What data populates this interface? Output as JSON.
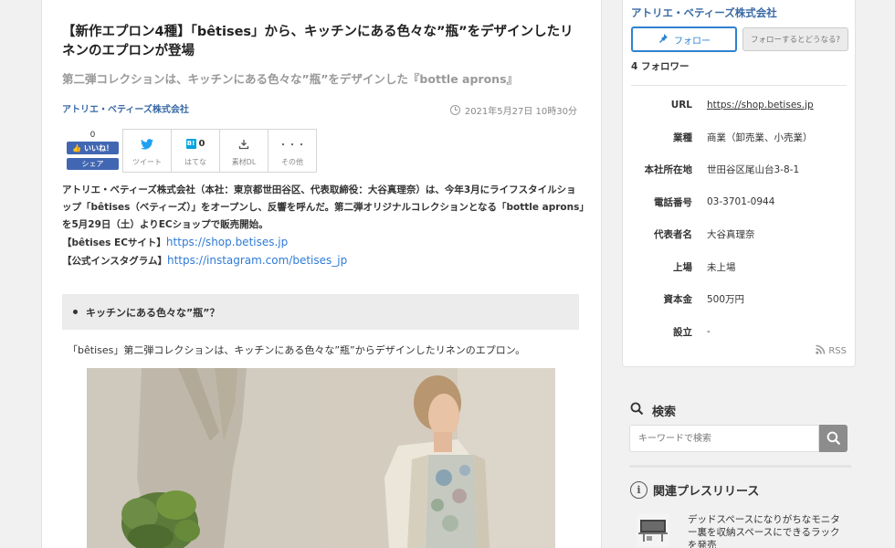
{
  "article": {
    "title": "【新作エプロン4種】「bêtises」から、キッチンにある色々な”瓶”をデザインしたリネンのエプロンが登場",
    "subtitle": "第二弾コレクションは、キッチンにある色々な”瓶”をデザインした『bottle aprons』",
    "company": "アトリエ・ベティーズ株式会社",
    "date": "2021年5月27日 10時30分",
    "body": [
      "アトリエ・ベティーズ株式会社（本社：東京都世田谷区、代表取締役：大谷真理奈）は、今年3月にライフスタイルショップ「bêtises（ベティーズ）」をオープンし、反響を呼んだ。第二弾オリジナルコレクションとなる「bottle aprons」を5月29日（土）よりECショップで販売開始。"
    ],
    "links": [
      {
        "label": "【bêtises ECサイト】",
        "url": "https://shop.betises.jp"
      },
      {
        "label": "【公式インスタグラム】",
        "url": "https://instagram.com/betises_jp"
      }
    ],
    "toc_item": "キッチンにある色々な”瓶”？",
    "lead": "「bêtises」第二弾コレクションは、キッチンにある色々な”瓶”からデザインしたリネンのエプロン。"
  },
  "share": {
    "fb_count": "0",
    "fb_like": "いいね！",
    "fb_share": "シェア",
    "tweet": "ツイート",
    "hatena_count": "0",
    "hatena": "はてな",
    "material": "素材DL",
    "more_icon": "・・・",
    "more": "その他"
  },
  "sidebar": {
    "company": "アトリエ・ベティーズ株式会社",
    "follow": "フォロー",
    "what_follow": "フォローするとどうなる?",
    "followers": "4 フォロワー",
    "info": [
      {
        "key": "URL",
        "value": "https://shop.betises.jp"
      },
      {
        "key": "業種",
        "value": "商業（卸売業、小売業）"
      },
      {
        "key": "本社所在地",
        "value": "世田谷区尾山台3-8-1"
      },
      {
        "key": "電話番号",
        "value": "03-3701-0944"
      },
      {
        "key": "代表者名",
        "value": "大谷真理奈"
      },
      {
        "key": "上場",
        "value": "未上場"
      },
      {
        "key": "資本金",
        "value": "500万円"
      },
      {
        "key": "設立",
        "value": "-"
      }
    ],
    "rss": "RSS",
    "search_title": "検索",
    "search_placeholder": "キーワードで検索",
    "related_title": "関連プレスリリース",
    "related_item": "デッドスペースになりがちなモニター裏を収納スペースにできるラックを発売"
  }
}
